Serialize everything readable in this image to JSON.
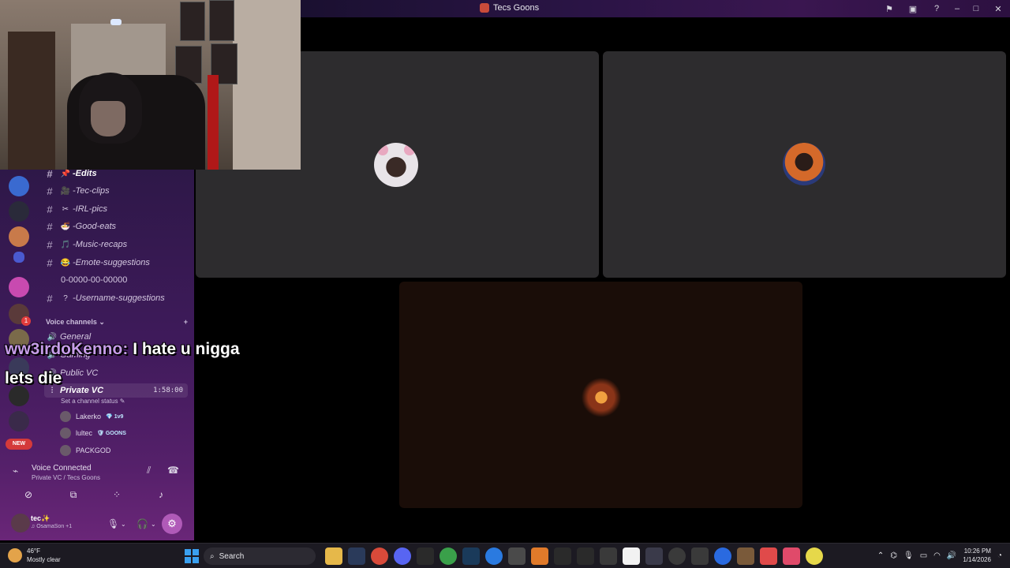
{
  "window": {
    "title": "Tecs Goons"
  },
  "channels": [
    {
      "emoji": "📌",
      "label": "-Edits"
    },
    {
      "emoji": "🎥",
      "label": "-Tec-clips"
    },
    {
      "emoji": "✂",
      "label": "-IRL-pics"
    },
    {
      "emoji": "🍜",
      "label": "-Good-eats"
    },
    {
      "emoji": "🎵",
      "label": "-Music-recaps"
    },
    {
      "emoji": "😂",
      "label": "-Emote-suggestions"
    },
    {
      "emoji": "",
      "label": "0-0000-00-00000"
    },
    {
      "emoji": "?",
      "label": "-Username-suggestions"
    }
  ],
  "voice_section": {
    "label": "Voice channels ⌄",
    "add": "+"
  },
  "voice_channels": [
    {
      "label": "General"
    },
    {
      "label": "Gaming"
    },
    {
      "label": "Public VC"
    },
    {
      "label": "Private VC",
      "time": "1:58:00"
    }
  ],
  "channel_status": "Set a channel status ✎",
  "members": [
    {
      "name": "Lakerko",
      "tag": "💎 1v9"
    },
    {
      "name": "lultec",
      "tag": "🛡 GOONS"
    },
    {
      "name": "PACKGOD",
      "tag": ""
    }
  ],
  "voice_panel": {
    "title": "Voice Connected",
    "subtitle": "Private VC / Tecs Goons"
  },
  "user": {
    "name": "tec✨",
    "sub": "♫ OsamaSon +1"
  },
  "server_badge": "1",
  "new_badge": "NEW",
  "overlay": {
    "username": "ww3irdoKenno:",
    "message": "I hate u nigga",
    "line2": "lets die"
  },
  "taskbar": {
    "weather_temp": "46°F",
    "weather_desc": "Mostly clear",
    "search": "Search",
    "time": "10:26 PM",
    "date": "1/14/2026"
  },
  "colors": {
    "titlebar": "#2a1445",
    "sidebar": "#3e1a5a",
    "tile": "#2d2c2e",
    "accent": "#b05ab8"
  }
}
